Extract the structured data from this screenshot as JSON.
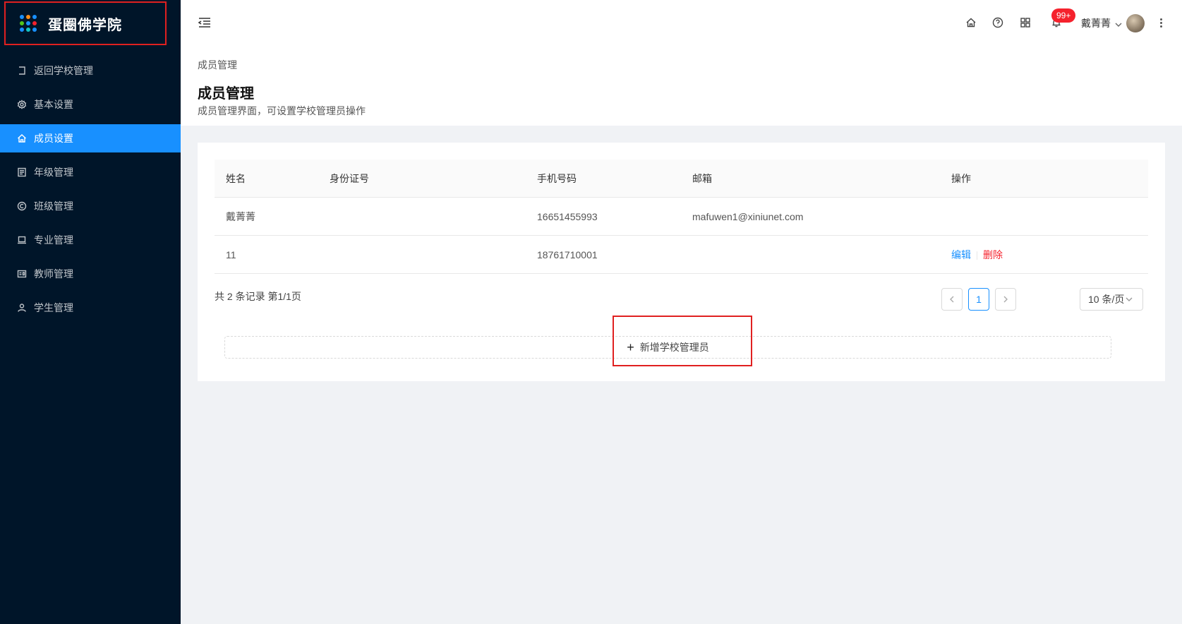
{
  "brand": {
    "name": "蛋圈佛学院"
  },
  "sidebar": {
    "items": [
      {
        "label": "返回学校管理",
        "icon": "back-icon",
        "active": false
      },
      {
        "label": "基本设置",
        "icon": "gear-icon",
        "active": false
      },
      {
        "label": "成员设置",
        "icon": "home-icon",
        "active": true
      },
      {
        "label": "年级管理",
        "icon": "list-icon",
        "active": false
      },
      {
        "label": "班级管理",
        "icon": "copyright-icon",
        "active": false
      },
      {
        "label": "专业管理",
        "icon": "laptop-icon",
        "active": false
      },
      {
        "label": "教师管理",
        "icon": "idcard-icon",
        "active": false
      },
      {
        "label": "学生管理",
        "icon": "user-icon",
        "active": false
      }
    ]
  },
  "header": {
    "notification_badge": "99+",
    "user_name": "戴菁菁"
  },
  "page": {
    "breadcrumb": "成员管理",
    "title": "成员管理",
    "description": "成员管理界面，可设置学校管理员操作"
  },
  "table": {
    "columns": [
      "姓名",
      "身份证号",
      "手机号码",
      "邮箱",
      "操作"
    ],
    "rows": [
      {
        "name": "戴菁菁",
        "id_number": "",
        "phone": "16651455993",
        "email": "mafuwen1@xiniunet.com",
        "edit": "",
        "delete": ""
      },
      {
        "name": "11",
        "id_number": "",
        "phone": "18761710001",
        "email": "",
        "edit": "编辑",
        "delete": "删除"
      }
    ]
  },
  "pagination": {
    "summary": "共 2 条记录 第1/1页",
    "current_page": "1",
    "page_size": "10 条/页"
  },
  "actions": {
    "add_admin": "新增学校管理员"
  },
  "colors": {
    "sidebar_bg": "#001529",
    "accent": "#1890ff",
    "danger": "#f5222d",
    "highlight": "#e02020"
  }
}
